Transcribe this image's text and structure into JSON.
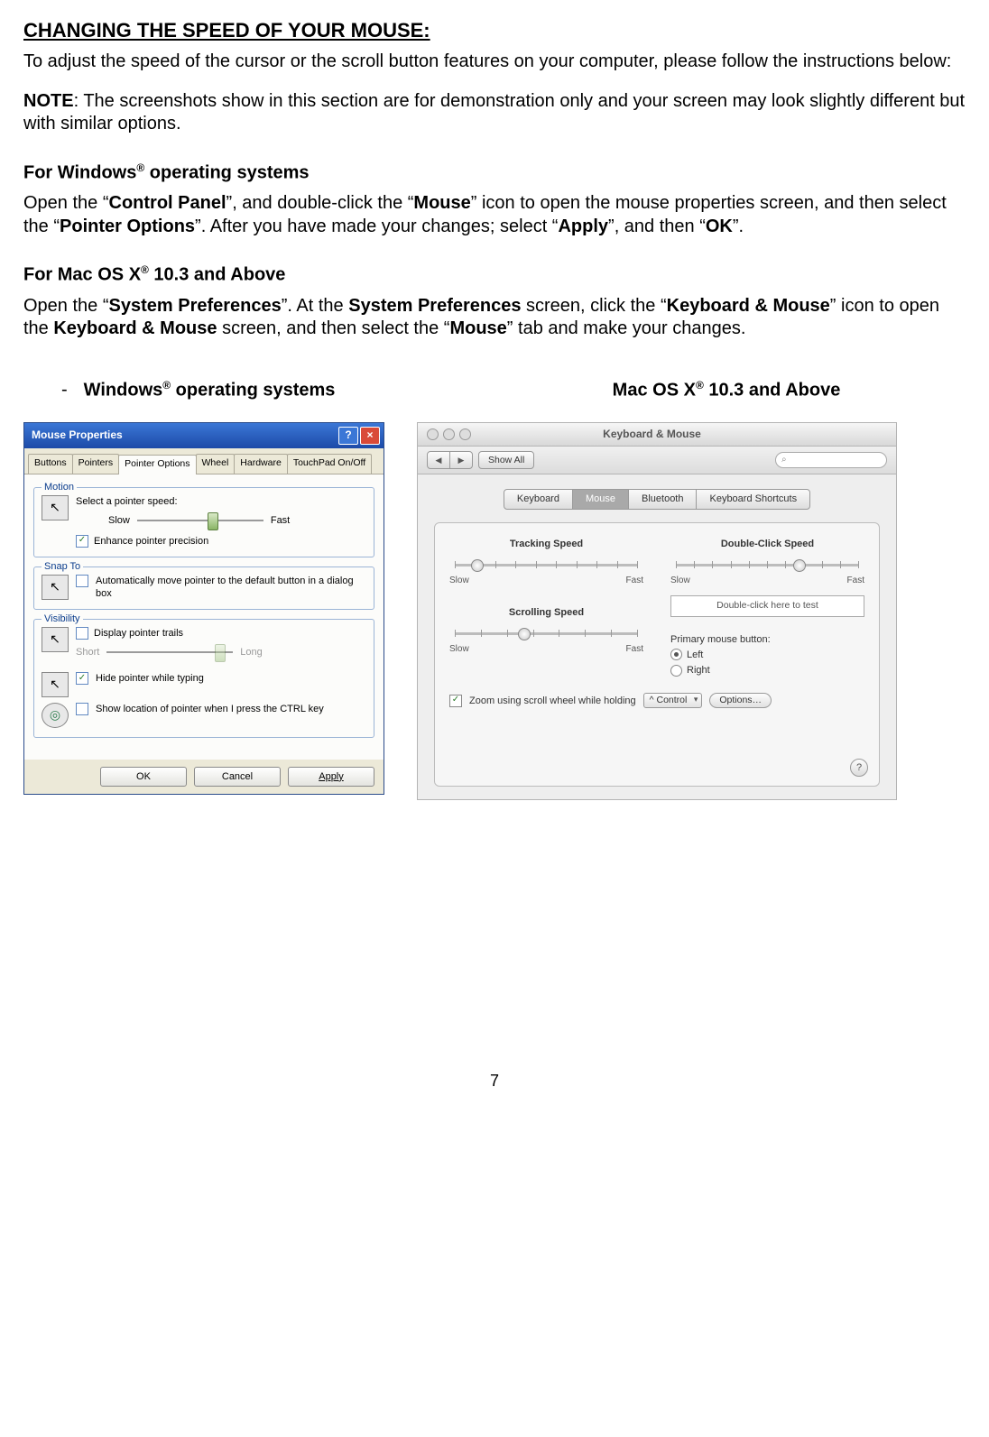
{
  "heading": "CHANGING THE SPEED OF YOUR MOUSE:",
  "intro": "To adjust the speed of the cursor or the scroll button features on your computer, please follow the instructions below:",
  "note_label": "NOTE",
  "note_text": ": The screenshots show in this section are for demonstration only and your screen may look slightly different but with similar options.",
  "win_section_title": "For Windows",
  "win_section_title_suffix": " operating systems",
  "win_para_1": "Open the “",
  "win_cp": "Control Panel",
  "win_para_2": "”, and double-click the “",
  "win_mouse": "Mouse",
  "win_para_3": "” icon to open the mouse properties screen, and then select the “",
  "win_po": "Pointer Options",
  "win_para_4": "”. After you have made your changes; select “",
  "win_apply": "Apply",
  "win_para_5": "”, and then “",
  "win_ok": "OK",
  "win_para_6": "”.",
  "mac_section_title": "For Mac OS X",
  "mac_section_title_suffix": "  10.3 and Above",
  "mac_para_1": "Open the “",
  "mac_sp": "System Preferences",
  "mac_para_2": "”. At the ",
  "mac_sp2": "System Preferences",
  "mac_para_3": " screen, click the “",
  "mac_km": "Keyboard & Mouse",
  "mac_para_4": "” icon to open the ",
  "mac_km2": "Keyboard & Mouse",
  "mac_para_5": " screen, and then select the “",
  "mac_mouse": "Mouse",
  "mac_para_6": "” tab and make your changes.",
  "col_win_head": "Windows",
  "col_win_head_suffix": " operating systems",
  "col_mac_head": "Mac OS X",
  "col_mac_head_suffix": "  10.3 and Above",
  "page_number": "7",
  "win_dlg": {
    "title": "Mouse Properties",
    "tabs": [
      "Buttons",
      "Pointers",
      "Pointer Options",
      "Wheel",
      "Hardware",
      "TouchPad On/Off"
    ],
    "motion_legend": "Motion",
    "select_speed": "Select a pointer speed:",
    "slow": "Slow",
    "fast": "Fast",
    "enhance": "Enhance pointer precision",
    "snap_legend": "Snap To",
    "snap_text": "Automatically move pointer to the default button in a dialog box",
    "vis_legend": "Visibility",
    "trails": "Display pointer trails",
    "short": "Short",
    "long": "Long",
    "hide": "Hide pointer while typing",
    "ctrl": "Show location of pointer when I press the CTRL key",
    "btn_ok": "OK",
    "btn_cancel": "Cancel",
    "btn_apply": "Apply"
  },
  "mac_dlg": {
    "title": "Keyboard & Mouse",
    "show_all": "Show All",
    "tabs": [
      "Keyboard",
      "Mouse",
      "Bluetooth",
      "Keyboard Shortcuts"
    ],
    "tracking": "Tracking Speed",
    "dclick": "Double-Click Speed",
    "scrolling": "Scrolling Speed",
    "slow": "Slow",
    "fast": "Fast",
    "test": "Double-click here to test",
    "primary": "Primary mouse button:",
    "left": "Left",
    "right": "Right",
    "zoom": "Zoom using scroll wheel while holding",
    "control": "^ Control",
    "options": "Options…"
  }
}
